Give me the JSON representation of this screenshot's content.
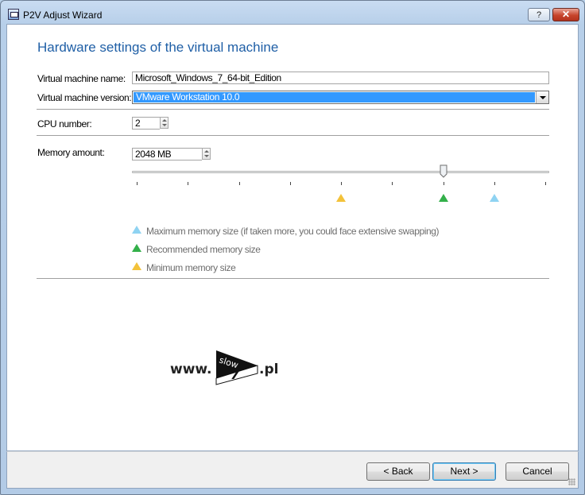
{
  "window": {
    "title": "P2V Adjust Wizard",
    "help_label": "?",
    "close_label": "✕"
  },
  "page": {
    "heading": "Hardware settings of the virtual machine"
  },
  "form": {
    "vm_name_label": "Virtual machine name:",
    "vm_name_value": "Microsoft_Windows_7_64-bit_Edition",
    "vm_version_label": "Virtual machine version:",
    "vm_version_value": "VMware Workstation 10.0",
    "cpu_label": "CPU number:",
    "cpu_value": "2",
    "memory_label": "Memory amount:",
    "memory_value": "2048 MB"
  },
  "memory_slider": {
    "tick_count": 9,
    "value_fraction": 0.75,
    "minimum_fraction": 0.5,
    "recommended_fraction": 0.75,
    "maximum_fraction": 0.875
  },
  "legend": {
    "maximum": "Maximum memory size (if taken more, you could face extensive swapping)",
    "recommended": "Recommended memory size",
    "minimum": "Minimum memory size"
  },
  "colors": {
    "maximum": "#8fd3f2",
    "recommended": "#33b04a",
    "minimum": "#f3c23a",
    "heading": "#1f5fa6"
  },
  "watermark": {
    "prefix": "www.",
    "flag_top": "slow",
    "flag_number": "7",
    "suffix": ".pl"
  },
  "buttons": {
    "back": "< Back",
    "next": "Next >",
    "cancel": "Cancel"
  }
}
